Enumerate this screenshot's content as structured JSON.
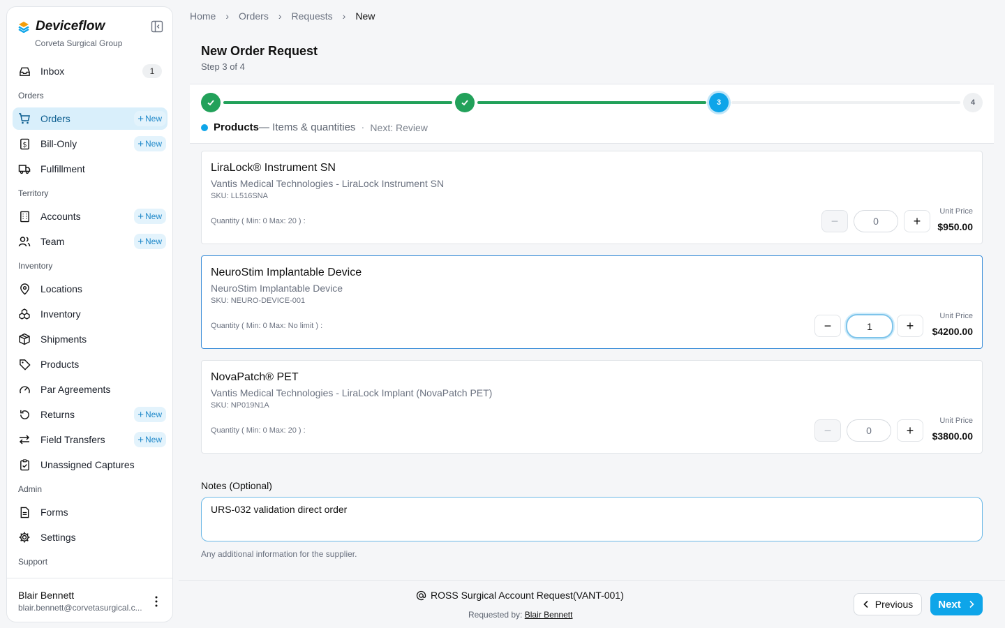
{
  "app": {
    "name": "Deviceflow",
    "org": "Corveta Surgical Group"
  },
  "sidebar": {
    "inbox": {
      "label": "Inbox",
      "count": "1"
    },
    "sections": [
      "Orders",
      "Territory",
      "Inventory",
      "Admin",
      "Support"
    ],
    "new_label": "New",
    "items": [
      {
        "label": "Orders"
      },
      {
        "label": "Bill-Only"
      },
      {
        "label": "Fulfillment"
      },
      {
        "label": "Accounts"
      },
      {
        "label": "Team"
      },
      {
        "label": "Locations"
      },
      {
        "label": "Inventory"
      },
      {
        "label": "Shipments"
      },
      {
        "label": "Products"
      },
      {
        "label": "Par Agreements"
      },
      {
        "label": "Returns"
      },
      {
        "label": "Field Transfers"
      },
      {
        "label": "Unassigned Captures"
      },
      {
        "label": "Forms"
      },
      {
        "label": "Settings"
      }
    ],
    "user": {
      "name": "Blair Bennett",
      "email": "blair.bennett@corvetasurgical.c..."
    }
  },
  "breadcrumb": [
    "Home",
    "Orders",
    "Requests",
    "New"
  ],
  "page": {
    "title": "New Order Request",
    "step_text": "Step 3 of 4"
  },
  "stepper": {
    "current_step": "3",
    "last_step": "4",
    "label": "Products",
    "detail": "— Items & quantities",
    "sep": "·",
    "next": "Next: Review"
  },
  "products": [
    {
      "name": "LiraLock® Instrument SN",
      "desc": "Vantis Medical Technologies - LiraLock Instrument SN",
      "sku": "SKU: LL516SNA",
      "qty_label": "Quantity  ( Min: 0 Max: 20 ) :",
      "qty": "0",
      "unit_label": "Unit Price",
      "price": "$950.00"
    },
    {
      "name": "NeuroStim Implantable Device",
      "desc": "NeuroStim Implantable Device",
      "sku": "SKU: NEURO-DEVICE-001",
      "qty_label": "Quantity  ( Min: 0 Max: No limit ) :",
      "qty": "1",
      "unit_label": "Unit Price",
      "price": "$4200.00"
    },
    {
      "name": "NovaPatch® PET",
      "desc": "Vantis Medical Technologies - LiraLock Implant (NovaPatch PET)",
      "sku": "SKU: NP019N1A",
      "qty_label": "Quantity  ( Min: 0 Max: 20 ) :",
      "qty": "0",
      "unit_label": "Unit Price",
      "price": "$3800.00"
    }
  ],
  "notes": {
    "label": "Notes (Optional)",
    "value": "URS-032 validation direct order",
    "help": "Any additional information for the supplier."
  },
  "footer": {
    "account": "ROSS Surgical Account Request(VANT-001)",
    "requested_by_label": "Requested by:",
    "requested_by": "Blair Bennett",
    "prev": "Previous",
    "next": "Next"
  },
  "colors": {
    "accent": "#0ea5e9",
    "success": "#22a15a",
    "active_bg": "#d9effb"
  }
}
